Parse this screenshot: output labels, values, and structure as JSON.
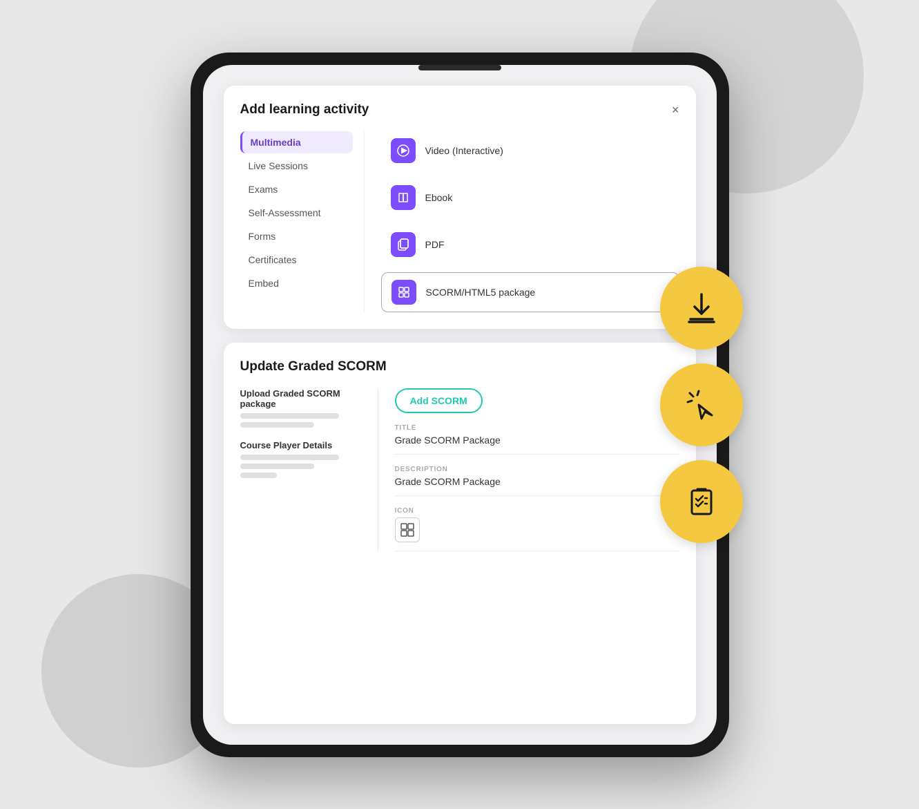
{
  "background": {
    "color": "#e8e8e8"
  },
  "modal": {
    "title": "Add learning activity",
    "close_label": "×",
    "nav_items": [
      {
        "id": "multimedia",
        "label": "Multimedia",
        "active": true
      },
      {
        "id": "live-sessions",
        "label": "Live Sessions",
        "active": false
      },
      {
        "id": "exams",
        "label": "Exams",
        "active": false
      },
      {
        "id": "self-assessment",
        "label": "Self-Assessment",
        "active": false
      },
      {
        "id": "forms",
        "label": "Forms",
        "active": false
      },
      {
        "id": "certificates",
        "label": "Certificates",
        "active": false
      },
      {
        "id": "embed",
        "label": "Embed",
        "active": false
      }
    ],
    "activities": [
      {
        "id": "video",
        "label": "Video (Interactive)",
        "icon": "play"
      },
      {
        "id": "ebook",
        "label": "Ebook",
        "icon": "book"
      },
      {
        "id": "pdf",
        "label": "PDF",
        "icon": "copy"
      },
      {
        "id": "scorm",
        "label": "SCORM/HTML5 package",
        "icon": "grid",
        "selected": true
      }
    ]
  },
  "scorm_panel": {
    "title": "Update Graded SCORM",
    "upload_label": "Upload Graded SCORM package",
    "player_label": "Course Player Details",
    "add_scorm_btn": "Add SCORM",
    "fields": [
      {
        "id": "title",
        "label": "TITLE",
        "value": "Grade SCORM Package"
      },
      {
        "id": "description",
        "label": "DESCRIPTION",
        "value": "Grade SCORM Package"
      },
      {
        "id": "icon",
        "label": "ICON",
        "value": ""
      }
    ]
  },
  "circles": [
    {
      "id": "download",
      "icon": "download"
    },
    {
      "id": "click",
      "icon": "cursor"
    },
    {
      "id": "checklist",
      "icon": "checklist"
    }
  ]
}
